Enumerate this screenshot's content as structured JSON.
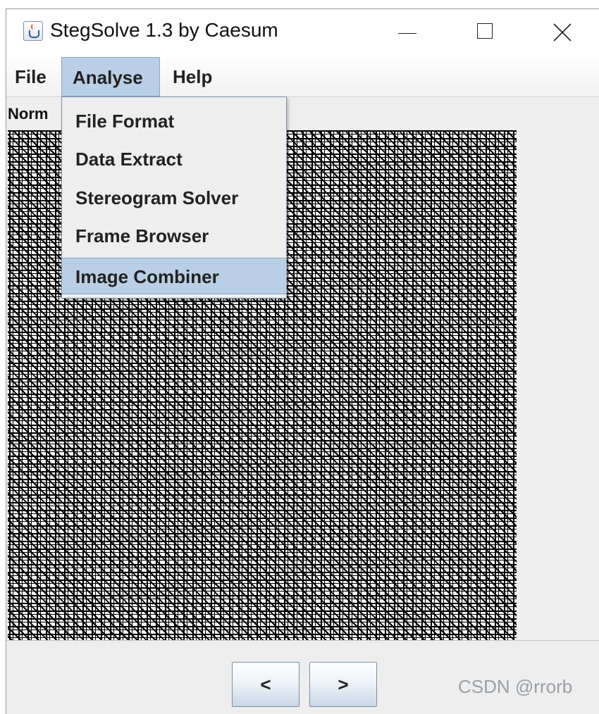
{
  "window": {
    "title": "StegSolve 1.3 by Caesum"
  },
  "menubar": {
    "items": [
      {
        "label": "File"
      },
      {
        "label": "Analyse"
      },
      {
        "label": "Help"
      }
    ]
  },
  "analyse_menu": {
    "items": [
      {
        "label": "File Format"
      },
      {
        "label": "Data Extract"
      },
      {
        "label": "Stereogram Solver"
      },
      {
        "label": "Frame Browser"
      },
      {
        "label": "Image Combiner"
      }
    ],
    "highlighted": "Image Combiner"
  },
  "view": {
    "label": "Norm"
  },
  "navigation": {
    "prev_label": "<",
    "next_label": ">"
  },
  "watermark": "CSDN @rrorb",
  "colors": {
    "menu_highlight": "#b8cfe5",
    "background": "#eeeeee"
  }
}
